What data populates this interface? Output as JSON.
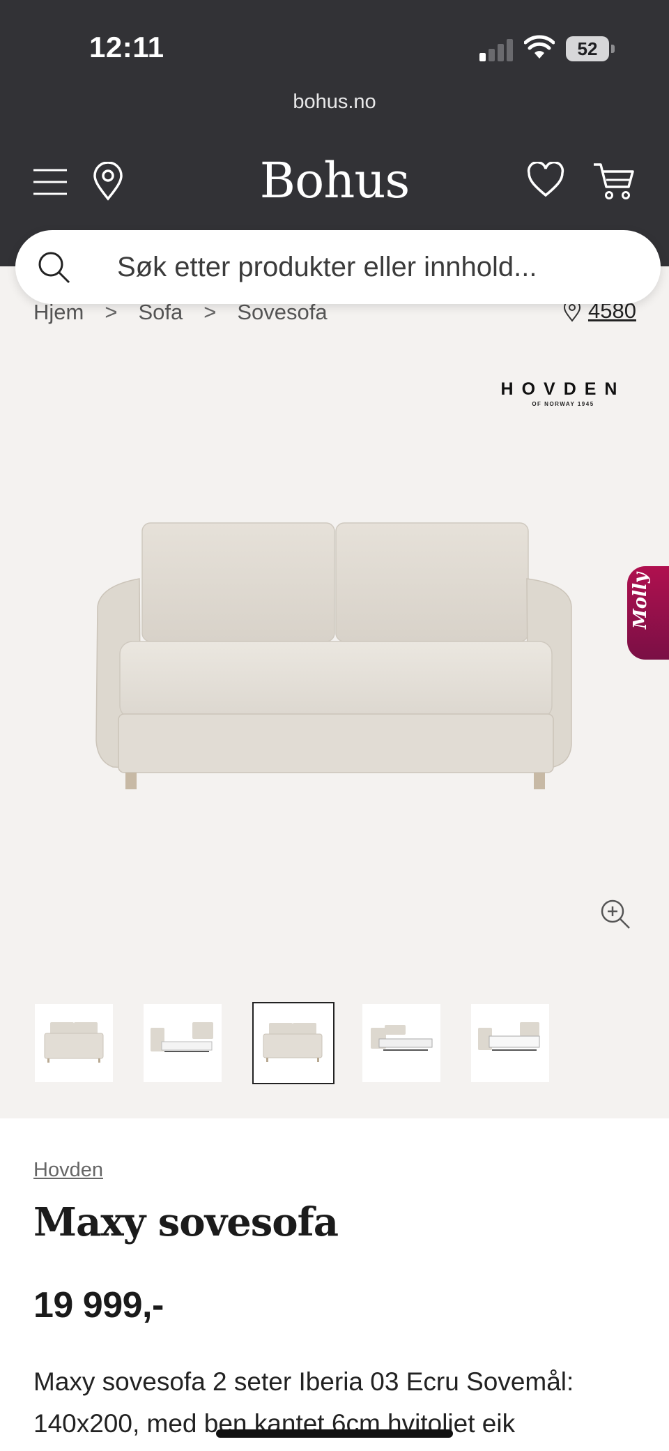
{
  "status_bar": {
    "time": "12:11",
    "battery": "52",
    "icons": [
      "signal-icon",
      "wifi-icon",
      "battery-icon"
    ]
  },
  "browser": {
    "url": "bohus.no"
  },
  "header": {
    "logo": "Bohus",
    "icons": [
      "menu-icon",
      "location-pin-icon",
      "heart-icon",
      "cart-icon"
    ]
  },
  "search": {
    "placeholder": "Søk etter produkter eller innhold..."
  },
  "breadcrumb": {
    "items": [
      "Hjem",
      "Sofa",
      "Sovesofa"
    ],
    "separator": ">"
  },
  "store_location": {
    "text": "4580"
  },
  "chat_widget": {
    "label": "Molly"
  },
  "gallery": {
    "brand_logo": "HOVDEN",
    "brand_logo_sub": "OF NORWAY 1945",
    "thumbnail_count": 5,
    "active_thumbnail": 3
  },
  "product": {
    "brand": "Hovden",
    "title": "Maxy sovesofa",
    "price": "19 999,-",
    "description": "Maxy sovesofa 2 seter Iberia 03 Ecru Sovemål: 140x200, med ben kantet 6cm hvitoljet eik"
  },
  "colors": {
    "header_bg": "#323236",
    "gallery_bg": "#f4f2f0",
    "molly_accent": "#9b104b",
    "sofa_fabric": "#e2ddd5"
  }
}
